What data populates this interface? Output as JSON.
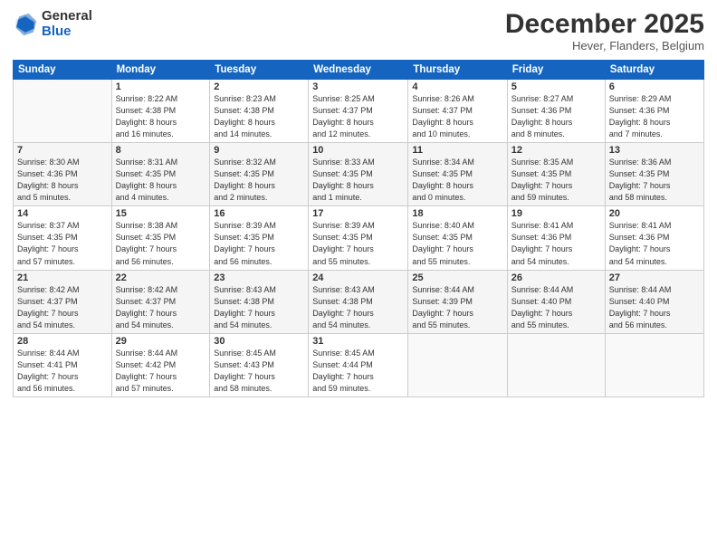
{
  "logo": {
    "general": "General",
    "blue": "Blue"
  },
  "header": {
    "month": "December 2025",
    "location": "Hever, Flanders, Belgium"
  },
  "weekdays": [
    "Sunday",
    "Monday",
    "Tuesday",
    "Wednesday",
    "Thursday",
    "Friday",
    "Saturday"
  ],
  "weeks": [
    [
      {
        "num": "",
        "info": ""
      },
      {
        "num": "1",
        "info": "Sunrise: 8:22 AM\nSunset: 4:38 PM\nDaylight: 8 hours\nand 16 minutes."
      },
      {
        "num": "2",
        "info": "Sunrise: 8:23 AM\nSunset: 4:38 PM\nDaylight: 8 hours\nand 14 minutes."
      },
      {
        "num": "3",
        "info": "Sunrise: 8:25 AM\nSunset: 4:37 PM\nDaylight: 8 hours\nand 12 minutes."
      },
      {
        "num": "4",
        "info": "Sunrise: 8:26 AM\nSunset: 4:37 PM\nDaylight: 8 hours\nand 10 minutes."
      },
      {
        "num": "5",
        "info": "Sunrise: 8:27 AM\nSunset: 4:36 PM\nDaylight: 8 hours\nand 8 minutes."
      },
      {
        "num": "6",
        "info": "Sunrise: 8:29 AM\nSunset: 4:36 PM\nDaylight: 8 hours\nand 7 minutes."
      }
    ],
    [
      {
        "num": "7",
        "info": "Sunrise: 8:30 AM\nSunset: 4:36 PM\nDaylight: 8 hours\nand 5 minutes."
      },
      {
        "num": "8",
        "info": "Sunrise: 8:31 AM\nSunset: 4:35 PM\nDaylight: 8 hours\nand 4 minutes."
      },
      {
        "num": "9",
        "info": "Sunrise: 8:32 AM\nSunset: 4:35 PM\nDaylight: 8 hours\nand 2 minutes."
      },
      {
        "num": "10",
        "info": "Sunrise: 8:33 AM\nSunset: 4:35 PM\nDaylight: 8 hours\nand 1 minute."
      },
      {
        "num": "11",
        "info": "Sunrise: 8:34 AM\nSunset: 4:35 PM\nDaylight: 8 hours\nand 0 minutes."
      },
      {
        "num": "12",
        "info": "Sunrise: 8:35 AM\nSunset: 4:35 PM\nDaylight: 7 hours\nand 59 minutes."
      },
      {
        "num": "13",
        "info": "Sunrise: 8:36 AM\nSunset: 4:35 PM\nDaylight: 7 hours\nand 58 minutes."
      }
    ],
    [
      {
        "num": "14",
        "info": "Sunrise: 8:37 AM\nSunset: 4:35 PM\nDaylight: 7 hours\nand 57 minutes."
      },
      {
        "num": "15",
        "info": "Sunrise: 8:38 AM\nSunset: 4:35 PM\nDaylight: 7 hours\nand 56 minutes."
      },
      {
        "num": "16",
        "info": "Sunrise: 8:39 AM\nSunset: 4:35 PM\nDaylight: 7 hours\nand 56 minutes."
      },
      {
        "num": "17",
        "info": "Sunrise: 8:39 AM\nSunset: 4:35 PM\nDaylight: 7 hours\nand 55 minutes."
      },
      {
        "num": "18",
        "info": "Sunrise: 8:40 AM\nSunset: 4:35 PM\nDaylight: 7 hours\nand 55 minutes."
      },
      {
        "num": "19",
        "info": "Sunrise: 8:41 AM\nSunset: 4:36 PM\nDaylight: 7 hours\nand 54 minutes."
      },
      {
        "num": "20",
        "info": "Sunrise: 8:41 AM\nSunset: 4:36 PM\nDaylight: 7 hours\nand 54 minutes."
      }
    ],
    [
      {
        "num": "21",
        "info": "Sunrise: 8:42 AM\nSunset: 4:37 PM\nDaylight: 7 hours\nand 54 minutes."
      },
      {
        "num": "22",
        "info": "Sunrise: 8:42 AM\nSunset: 4:37 PM\nDaylight: 7 hours\nand 54 minutes."
      },
      {
        "num": "23",
        "info": "Sunrise: 8:43 AM\nSunset: 4:38 PM\nDaylight: 7 hours\nand 54 minutes."
      },
      {
        "num": "24",
        "info": "Sunrise: 8:43 AM\nSunset: 4:38 PM\nDaylight: 7 hours\nand 54 minutes."
      },
      {
        "num": "25",
        "info": "Sunrise: 8:44 AM\nSunset: 4:39 PM\nDaylight: 7 hours\nand 55 minutes."
      },
      {
        "num": "26",
        "info": "Sunrise: 8:44 AM\nSunset: 4:40 PM\nDaylight: 7 hours\nand 55 minutes."
      },
      {
        "num": "27",
        "info": "Sunrise: 8:44 AM\nSunset: 4:40 PM\nDaylight: 7 hours\nand 56 minutes."
      }
    ],
    [
      {
        "num": "28",
        "info": "Sunrise: 8:44 AM\nSunset: 4:41 PM\nDaylight: 7 hours\nand 56 minutes."
      },
      {
        "num": "29",
        "info": "Sunrise: 8:44 AM\nSunset: 4:42 PM\nDaylight: 7 hours\nand 57 minutes."
      },
      {
        "num": "30",
        "info": "Sunrise: 8:45 AM\nSunset: 4:43 PM\nDaylight: 7 hours\nand 58 minutes."
      },
      {
        "num": "31",
        "info": "Sunrise: 8:45 AM\nSunset: 4:44 PM\nDaylight: 7 hours\nand 59 minutes."
      },
      {
        "num": "",
        "info": ""
      },
      {
        "num": "",
        "info": ""
      },
      {
        "num": "",
        "info": ""
      }
    ]
  ]
}
